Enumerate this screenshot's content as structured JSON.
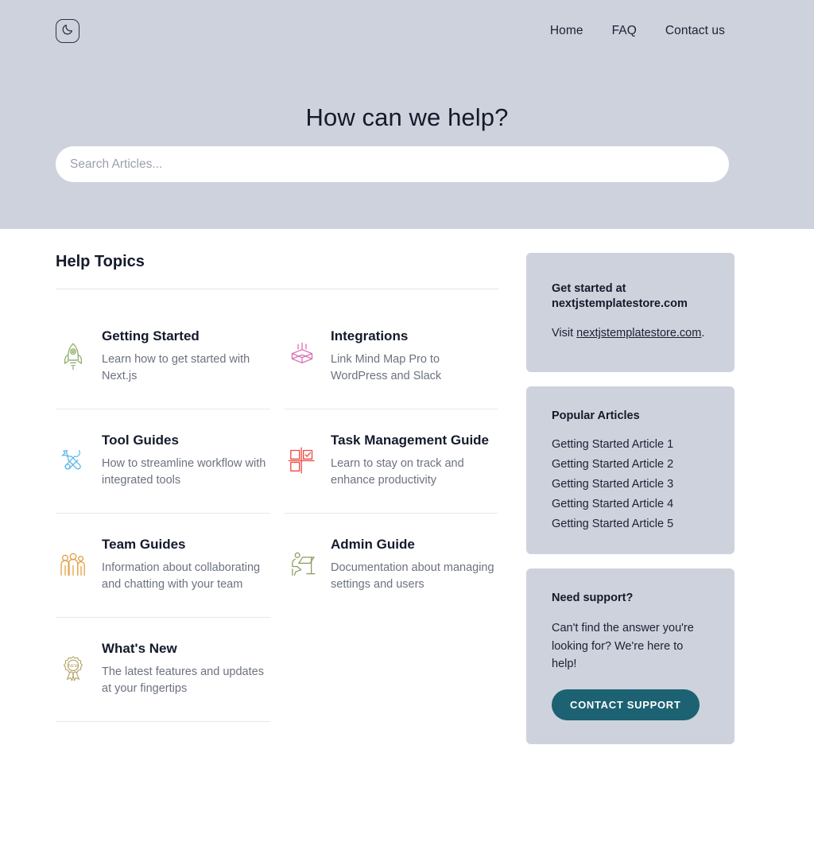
{
  "header": {
    "logo_icon": "moon-icon",
    "nav": [
      {
        "label": "Home"
      },
      {
        "label": "FAQ"
      },
      {
        "label": "Contact us"
      }
    ]
  },
  "hero": {
    "title": "How can we help?",
    "search_placeholder": "Search Articles...",
    "search_value": "",
    "background_color": "#ced2dc"
  },
  "help_topics": {
    "heading": "Help Topics",
    "items": [
      {
        "title": "Getting Started",
        "description": "Learn how to get started with Next.js",
        "icon": "rocket-icon",
        "icon_color": "#8cad6a"
      },
      {
        "title": "Integrations",
        "description": "Link Mind Map Pro to WordPress and Slack",
        "icon": "open-box-icon",
        "icon_color": "#d96ab0"
      },
      {
        "title": "Tool Guides",
        "description": "How to streamline workflow with integrated tools",
        "icon": "tools-icon",
        "icon_color": "#5bb7e8"
      },
      {
        "title": "Task Management Guide",
        "description": "Learn to stay on track and enhance productivity",
        "icon": "task-grid-check-icon",
        "icon_color": "#f04a44"
      },
      {
        "title": "Team Guides",
        "description": "Information about collaborating and chatting with your team",
        "icon": "people-group-icon",
        "icon_color": "#e79a3c"
      },
      {
        "title": "Admin Guide",
        "description": "Documentation about managing settings and users",
        "icon": "person-at-desk-icon",
        "icon_color": "#8a9c5f"
      },
      {
        "title": "What's New",
        "description": "The latest features and updates at your fingertips",
        "icon": "new-badge-icon",
        "icon_color": "#b5a66b"
      }
    ]
  },
  "sidebar": {
    "promo": {
      "title": "Get started at nextjstemplatestore.com",
      "text_before": "Visit ",
      "link_label": "nextjstemplatestore.com",
      "text_after": "."
    },
    "popular": {
      "title": "Popular Articles",
      "articles": [
        "Getting Started Article 1",
        "Getting Started Article 2",
        "Getting Started Article 3",
        "Getting Started Article 4",
        "Getting Started Article 5"
      ]
    },
    "support": {
      "title": "Need support?",
      "text": "Can't find the answer you're looking for? We're here to help!",
      "button_label": "CONTACT SUPPORT",
      "button_color": "#1c6272"
    }
  }
}
